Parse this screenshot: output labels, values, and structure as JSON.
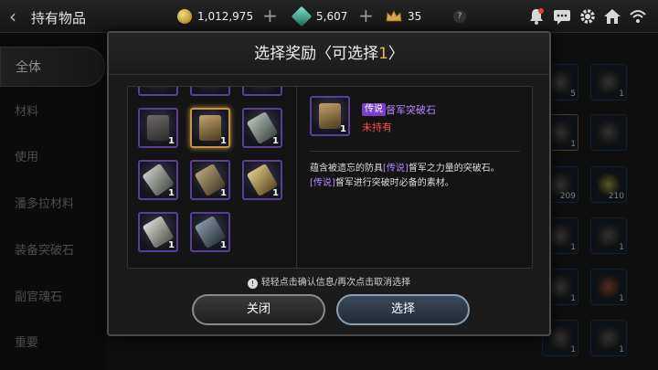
{
  "header": {
    "back_icon": "chevron-left-icon",
    "title": "持有物品",
    "gold": "1,012,975",
    "gems": "5,607",
    "crowns": "35",
    "help": "?"
  },
  "sidebar": {
    "items": [
      {
        "label": "全体"
      },
      {
        "label": "材料"
      },
      {
        "label": "使用"
      },
      {
        "label": "潘多拉材料"
      },
      {
        "label": "装备突破石"
      },
      {
        "label": "副官魂石"
      },
      {
        "label": "重要"
      }
    ]
  },
  "background_grid": {
    "counts": [
      "5",
      "1",
      "1",
      "209",
      "210",
      "1",
      "1",
      "1",
      "1",
      "1",
      "1"
    ]
  },
  "modal": {
    "title_prefix": "选择奖励〈可选择",
    "title_count": "1",
    "title_suffix": "〉",
    "items": [
      {
        "count": "1"
      },
      {
        "count": "1"
      },
      {
        "count": "1"
      },
      {
        "count": "1"
      },
      {
        "count": "1"
      },
      {
        "count": "1"
      },
      {
        "count": "1"
      },
      {
        "count": "1"
      }
    ],
    "selected_index": 1,
    "detail": {
      "count": "1",
      "grade": "传说",
      "name": "督军突破石",
      "owned_status": "未持有",
      "desc_line1_a": "蕴含被遗忘的防具",
      "desc_tag": "[传说]",
      "desc_line1_b": "督军之力量的突破石。",
      "desc_line2_b": "督军进行突破时必备的素材。"
    },
    "hint": "轻轻点击确认信息/再次点击取消选择",
    "close_label": "关闭",
    "confirm_label": "选择"
  },
  "colors": {
    "legend_purple": "#b585ff",
    "gold_accent": "#e9b64f",
    "not_owned_red": "#ff4a4a"
  }
}
